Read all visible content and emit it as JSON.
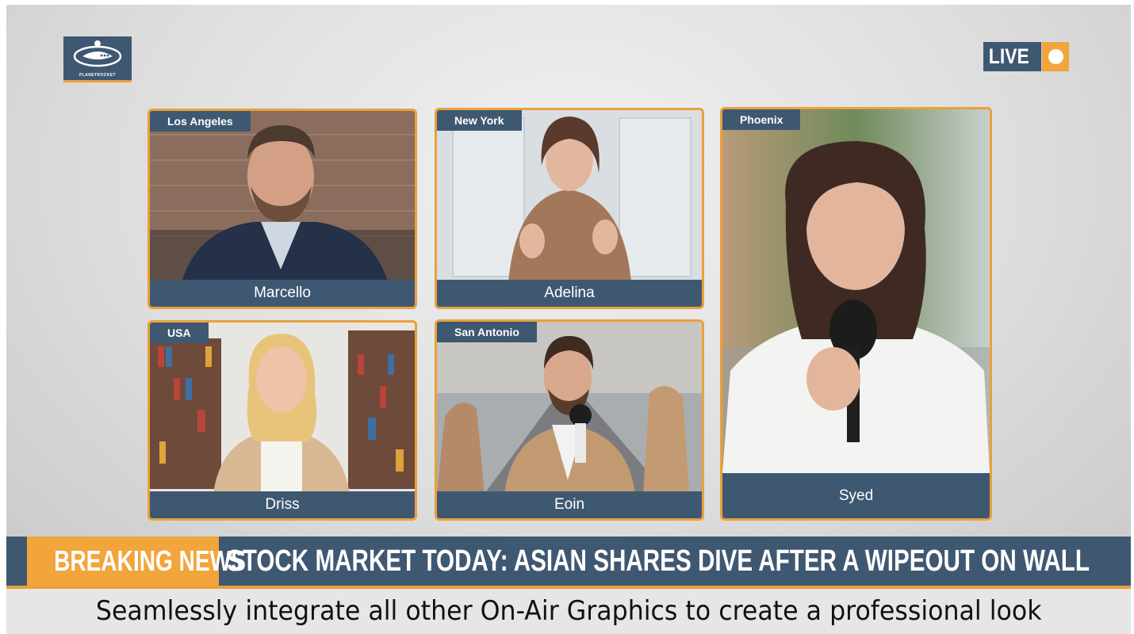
{
  "brand": {
    "logo_text": "PLANETROCKET"
  },
  "live_badge": {
    "label": "LIVE"
  },
  "panels": [
    {
      "location": "Los Angeles",
      "name": "Marcello"
    },
    {
      "location": "New York",
      "name": "Adelina"
    },
    {
      "location": "Phoenix",
      "name": "Syed"
    },
    {
      "location": "USA",
      "name": "Driss"
    },
    {
      "location": "San Antonio",
      "name": "Eoin"
    }
  ],
  "ticker": {
    "label": "BREAKING NEWS",
    "headline": "STOCK MARKET TODAY: ASIAN SHARES DIVE AFTER A WIPEOUT ON WALL STREET"
  },
  "caption": "Seamlessly integrate all other On-Air Graphics to create a professional look",
  "colors": {
    "navy": "#3f5872",
    "accent": "#e9a13a",
    "live_orange": "#f2a53a"
  }
}
